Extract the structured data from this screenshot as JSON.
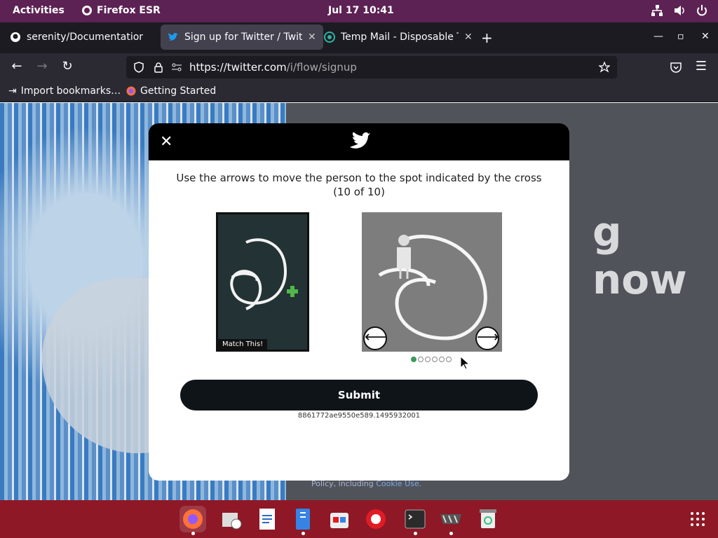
{
  "topbar": {
    "activities": "Activities",
    "app_name": "Firefox ESR",
    "clock": "Jul 17  10:41",
    "icons": [
      "network-icon",
      "volume-icon",
      "power-icon"
    ]
  },
  "tabs": [
    {
      "title": "serenity/Documentation/",
      "icon": "github-icon",
      "active": false
    },
    {
      "title": "Sign up for Twitter / Twitt",
      "icon": "twitter-icon",
      "active": true
    },
    {
      "title": "Temp Mail - Disposable T",
      "icon": "tempmail-icon",
      "active": false
    }
  ],
  "newtab": "+",
  "window_controls": {
    "minimize": "—",
    "maximize": "▫",
    "close": "✕"
  },
  "navbar": {
    "url_host": "https://twitter.com",
    "url_path": "/i/flow/signup"
  },
  "bookmarks": [
    {
      "label": "Import bookmarks…",
      "icon": "import-icon"
    },
    {
      "label": "Getting Started",
      "icon": "firefox-icon"
    }
  ],
  "background": {
    "headline": "g now",
    "footer_plain": "Policy, including ",
    "footer_link": "Cookie Use."
  },
  "dialog": {
    "close_label": "✕",
    "instruction": "Use the arrows to move the person to the spot indicated by the cross",
    "progress": "(10 of 10)",
    "target_caption": "Match This!",
    "left_arrow": "⟵",
    "right_arrow": "⟶",
    "dots_total": 6,
    "dots_active": 1,
    "submit_label": "Submit",
    "token": "8861772ae9550e589.1495932001"
  },
  "colors": {
    "topbar": "#5c2254",
    "tabbar": "#1c1b22",
    "dock": "#8e1826",
    "submit": "#0f1419",
    "active_dot": "#3a9a5a"
  },
  "dock": {
    "items": [
      {
        "name": "firefox-icon",
        "active": true
      },
      {
        "name": "evolution-icon",
        "active": false
      },
      {
        "name": "writer-icon",
        "active": false
      },
      {
        "name": "files-icon",
        "active": false
      },
      {
        "name": "software-icon",
        "active": false
      },
      {
        "name": "help-icon",
        "active": false
      },
      {
        "name": "terminal-icon",
        "active": false
      },
      {
        "name": "vim-icon",
        "active": false
      },
      {
        "name": "trash-icon",
        "active": false
      }
    ]
  }
}
